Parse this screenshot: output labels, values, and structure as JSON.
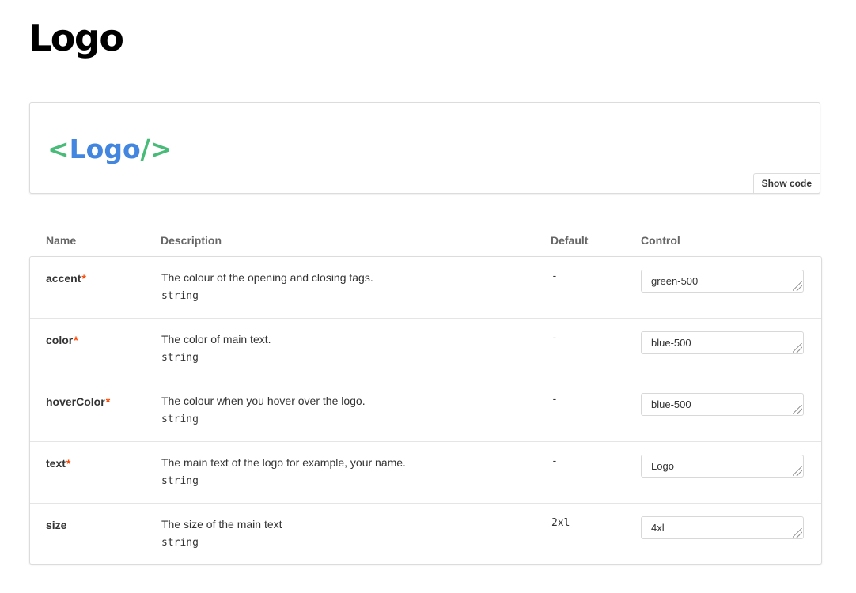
{
  "page": {
    "title": "Logo"
  },
  "preview": {
    "logo": {
      "open": "<",
      "text": "Logo",
      "close": "/>"
    },
    "show_code_label": "Show code",
    "colors": {
      "accent": "#48bb78",
      "text": "#4286e0"
    }
  },
  "props_table": {
    "columns": [
      "Name",
      "Description",
      "Default",
      "Control"
    ],
    "rows": [
      {
        "name": "accent",
        "required": "*",
        "description": "The colour of the opening and closing tags.",
        "type": "string",
        "default": "-",
        "control_value": "green-500"
      },
      {
        "name": "color",
        "required": "*",
        "description": "The color of main text.",
        "type": "string",
        "default": "-",
        "control_value": "blue-500"
      },
      {
        "name": "hoverColor",
        "required": "*",
        "description": "The colour when you hover over the logo.",
        "type": "string",
        "default": "-",
        "control_value": "blue-500"
      },
      {
        "name": "text",
        "required": "*",
        "description": "The main text of the logo for example, your name.",
        "type": "string",
        "default": "-",
        "control_value": "Logo"
      },
      {
        "name": "size",
        "required": "",
        "description": "The size of the main text",
        "type": "string",
        "default": "2xl",
        "control_value": "4xl"
      }
    ]
  }
}
